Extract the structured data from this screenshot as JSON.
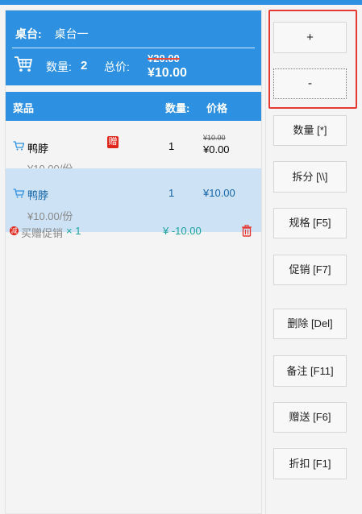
{
  "header": {
    "table_label": "桌台:",
    "table_value": "桌台一",
    "qty_label": "数量:",
    "qty_value": "2",
    "total_label": "总价:",
    "original_total": "¥20.00",
    "final_total": "¥10.00"
  },
  "table_header": {
    "dish": "菜品",
    "qty": "数量:",
    "price": "价格"
  },
  "items": [
    {
      "name": "鸭脖",
      "gift_badge": "赠",
      "unit_price": "¥10.00/份",
      "qty": "1",
      "original_price": "¥10.00",
      "price": "¥0.00"
    },
    {
      "name": "鸭脖",
      "unit_price": "¥10.00/份",
      "qty": "1",
      "price": "¥10.00",
      "promo_icon": "减",
      "promo_label": "买赠促销",
      "promo_qty": "× 1",
      "promo_discount": "¥  -10.00"
    }
  ],
  "buttons": {
    "plus": "+",
    "minus": "-",
    "quantity": "数量 [*]",
    "split": "拆分 [\\\\]",
    "spec": "规格 [F5]",
    "promo": "促销 [F7]",
    "delete": "删除 [Del]",
    "remark": "备注 [F11]",
    "gift": "赠送 [F6]",
    "discount": "折扣 [F1]"
  },
  "colors": {
    "accent": "#2e90e0",
    "selected_row": "#cde2f5",
    "danger": "#e53935",
    "promo_teal": "#1ba39c"
  }
}
